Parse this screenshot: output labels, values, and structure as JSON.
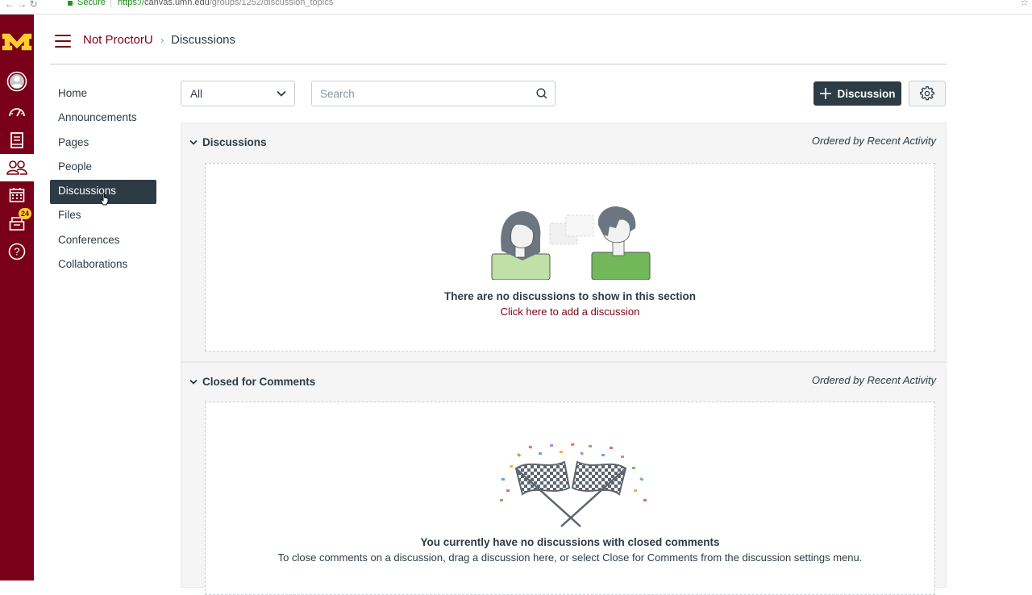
{
  "browser": {
    "nav_buttons": "← → ↻",
    "secure_label": "Secure",
    "url_scheme": "https://",
    "url_host": "canvas.umn.edu",
    "url_path": "/groups/1252/discussion_topics"
  },
  "global_nav": {
    "badge_count": "24",
    "items": [
      "account",
      "dashboard",
      "courses",
      "groups",
      "calendar",
      "inbox",
      "help"
    ]
  },
  "breadcrumb": {
    "course": "Not ProctorU",
    "separator": "›",
    "current": "Discussions"
  },
  "course_nav": {
    "items": [
      "Home",
      "Announcements",
      "Pages",
      "People",
      "Discussions",
      "Files",
      "Conferences",
      "Collaborations"
    ],
    "active": "Discussions"
  },
  "toolbar": {
    "filter_value": "All",
    "search_placeholder": "Search",
    "add_button_label": "Discussion"
  },
  "sections": {
    "discussions": {
      "title": "Discussions",
      "order": "Ordered by Recent Activity",
      "empty_title": "There are no discussions to show in this section",
      "empty_link": "Click here to add a discussion"
    },
    "closed": {
      "title": "Closed for Comments",
      "order": "Ordered by Recent Activity",
      "empty_title": "You currently have no discussions with closed comments",
      "empty_sub": "To close comments on a discussion, drag a discussion here, or select Close for Comments from the discussion settings menu."
    }
  },
  "colors": {
    "brand": "#7a0019",
    "nav_text": "#2d3b45",
    "badge": "#ffcc33",
    "active_bg": "#2d3b45"
  }
}
